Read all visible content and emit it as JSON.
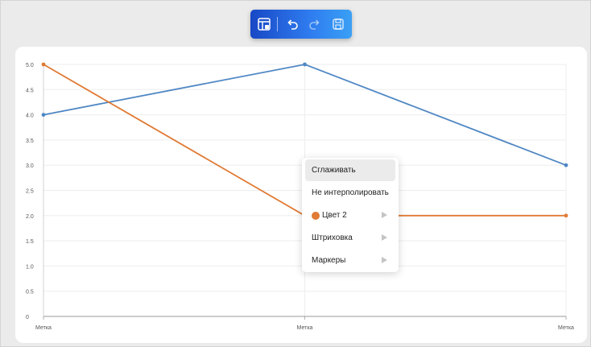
{
  "toolbar": {
    "buttons": [
      {
        "icon": "layout-settings-icon"
      },
      {
        "icon": "undo-icon"
      },
      {
        "icon": "redo-icon"
      },
      {
        "icon": "save-icon"
      }
    ]
  },
  "chart_data": {
    "type": "line",
    "categories": [
      "Метка",
      "Метка",
      "Метка"
    ],
    "series": [
      {
        "color": "#4f87c4",
        "values": [
          4.0,
          5.0,
          3.0
        ]
      },
      {
        "color": "#e07a34",
        "values": [
          5.0,
          2.0,
          2.0
        ]
      }
    ],
    "y_ticks": [
      "0",
      "0.5",
      "1.0",
      "1.5",
      "2.0",
      "2.5",
      "3.0",
      "3.5",
      "4.0",
      "4.5",
      "5.0"
    ],
    "ylim": [
      0,
      5
    ],
    "grid": true,
    "title": "",
    "xlabel": "",
    "ylabel": ""
  },
  "context_menu": {
    "items": [
      {
        "label": "Сглаживать"
      },
      {
        "label": "Не интерполировать"
      },
      {
        "label": "Цвет 2",
        "swatch": "#e07a34"
      },
      {
        "label": "Штриховка"
      },
      {
        "label": "Маркеры"
      }
    ]
  }
}
